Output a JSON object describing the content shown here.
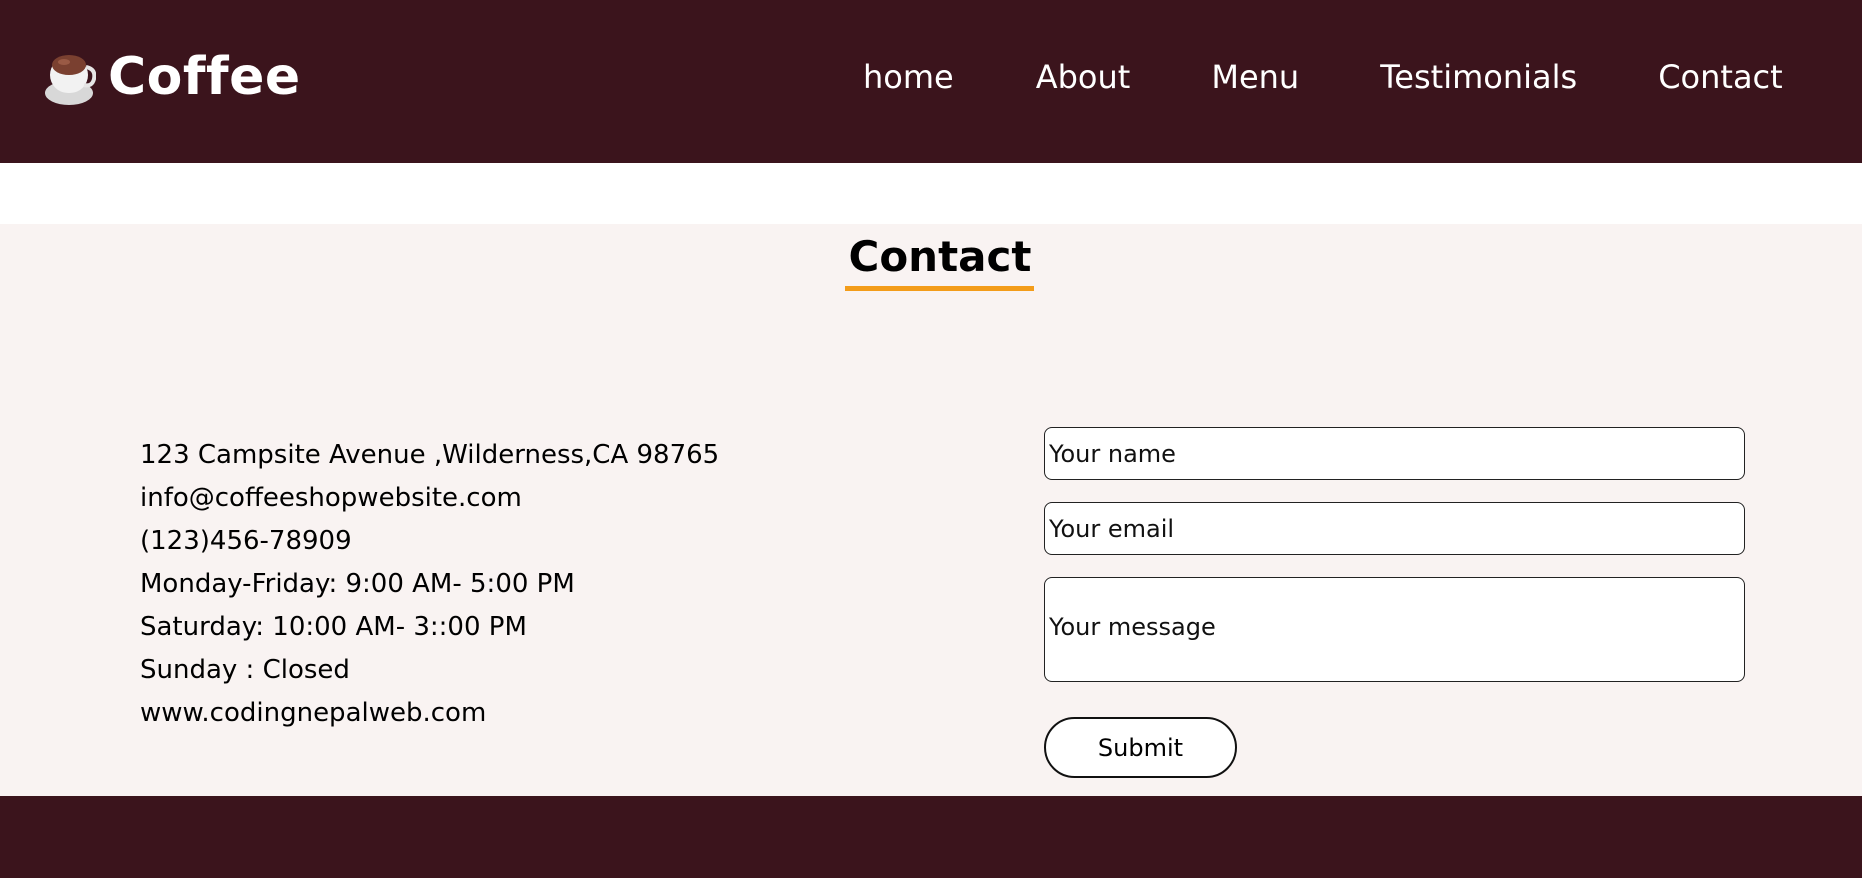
{
  "header": {
    "brand_title": "Coffee",
    "logo_icon": "coffee-cup-icon",
    "nav": [
      "home",
      "About",
      "Menu",
      "Testimonials",
      "Contact"
    ]
  },
  "contact": {
    "title": "Contact",
    "info": [
      "123 Campsite Avenue ,Wilderness,CA 98765",
      "info@coffeeshopwebsite.com",
      "(123)456-78909",
      "Monday-Friday: 9:00 AM- 5:00 PM",
      "Saturday: 10:00 AM- 3::00 PM",
      "Sunday : Closed",
      "www.codingnepalweb.com"
    ],
    "form": {
      "name_placeholder": "Your name",
      "email_placeholder": "Your email",
      "message_placeholder": "Your message",
      "submit_label": "Submit"
    }
  },
  "colors": {
    "header_bg": "#3b141c",
    "section_bg": "#f9f3f2",
    "accent": "#f39c1a"
  }
}
